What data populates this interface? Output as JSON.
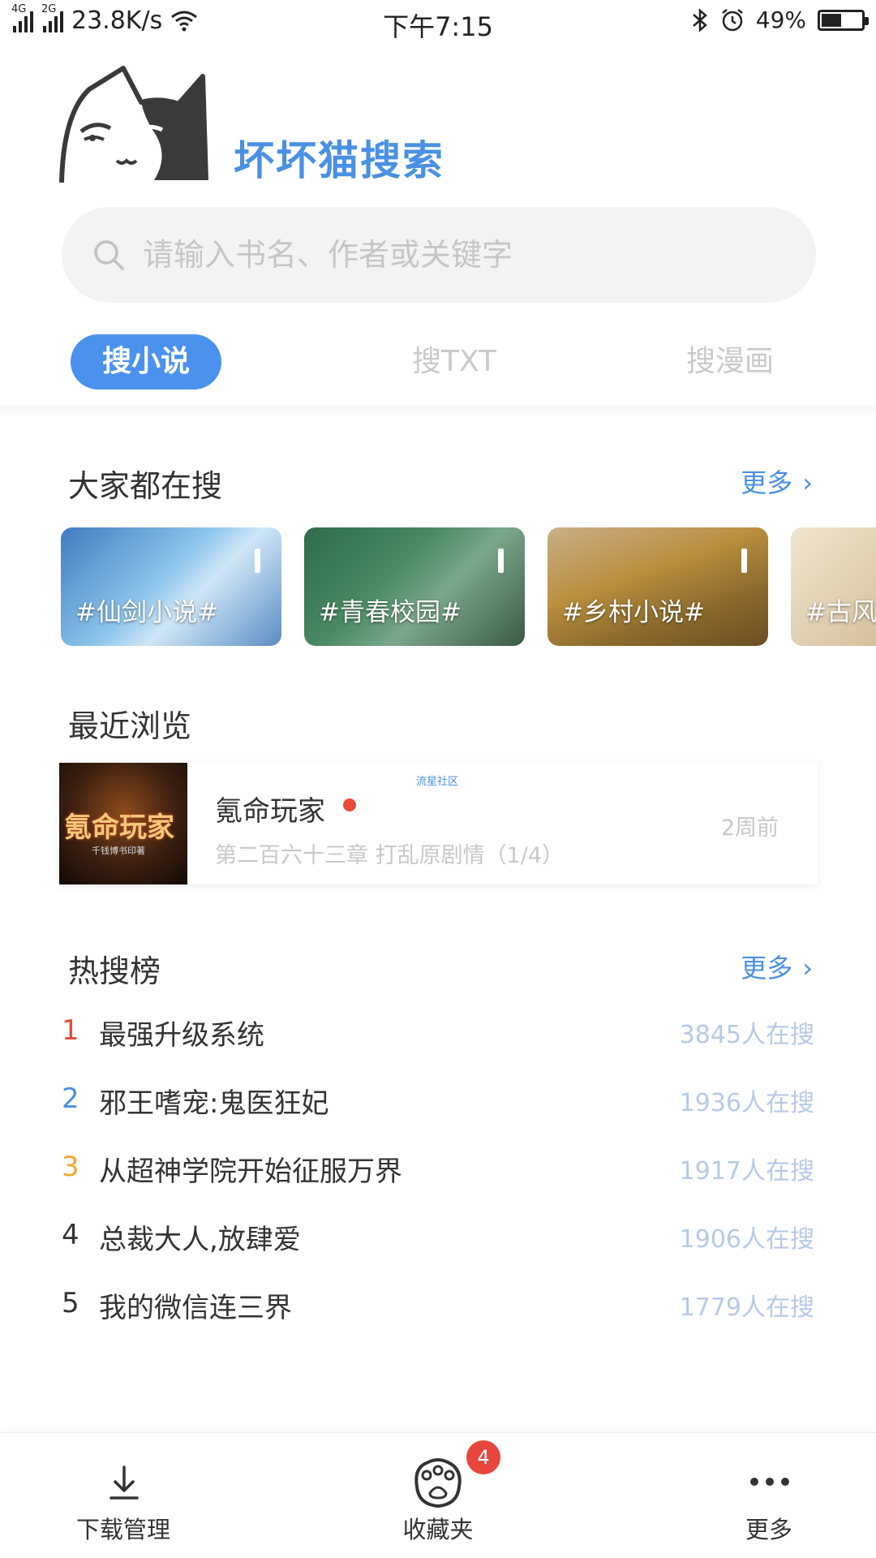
{
  "status_bar": {
    "net_type_1": "4G",
    "net_type_2": "2G",
    "speed": "23.8K/s",
    "time": "下午7:15",
    "battery": "49%",
    "battery_level": 0.49
  },
  "app": {
    "logo_text": "坏坏猫搜索"
  },
  "search": {
    "placeholder": "请输入书名、作者或关键字"
  },
  "tabs": [
    {
      "label": "搜小说",
      "active": true
    },
    {
      "label": "搜TXT",
      "active": false
    },
    {
      "label": "搜漫画",
      "active": false
    }
  ],
  "trending": {
    "title": "大家都在搜",
    "more": "更多",
    "topics": [
      {
        "label": "#仙剑小说#"
      },
      {
        "label": "#青春校园#"
      },
      {
        "label": "#乡村小说#"
      },
      {
        "label": "#古风"
      }
    ]
  },
  "recent": {
    "title": "最近浏览",
    "watermark": "流星社区",
    "book": {
      "cover_title": "氪命玩家",
      "cover_subtitle": "千钱博书印著",
      "title": "氪命玩家",
      "chapter": "第二百六十三章 打乱原剧情（1/4）",
      "time": "2周前"
    }
  },
  "hot": {
    "title": "热搜榜",
    "more": "更多",
    "items": [
      {
        "rank": "1",
        "name": "最强升级系统",
        "count": "3845人在搜",
        "rank_color": "#e84a3a"
      },
      {
        "rank": "2",
        "name": "邪王嗜宠:鬼医狂妃",
        "count": "1936人在搜",
        "rank_color": "#4a90e2"
      },
      {
        "rank": "3",
        "name": "从超神学院开始征服万界",
        "count": "1917人在搜",
        "rank_color": "#f0a830"
      },
      {
        "rank": "4",
        "name": "总裁大人,放肆爱",
        "count": "1906人在搜",
        "rank_color": "#333333"
      },
      {
        "rank": "5",
        "name": "我的微信连三界",
        "count": "1779人在搜",
        "rank_color": "#333333"
      }
    ]
  },
  "bottom_nav": {
    "download": "下载管理",
    "favorites": "收藏夹",
    "favorites_badge": "4",
    "more": "更多"
  }
}
